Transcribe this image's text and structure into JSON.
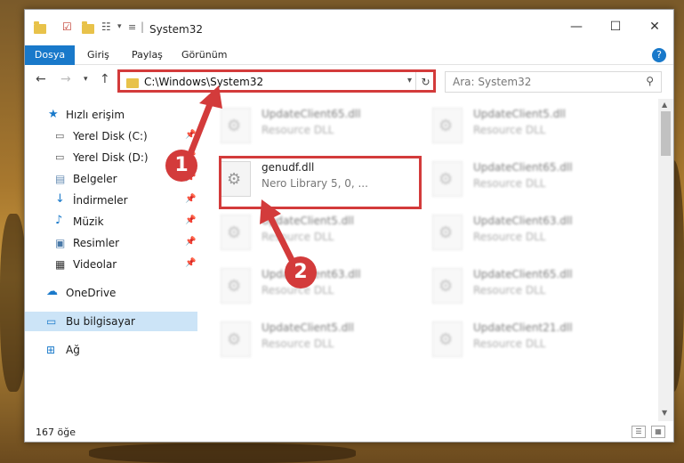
{
  "window": {
    "title": "System32",
    "controls": {
      "minimize": "—",
      "maximize": "☐",
      "close": "✕"
    }
  },
  "ribbon": {
    "tabs": [
      {
        "label": "Dosya",
        "active": true
      },
      {
        "label": "Giriş",
        "active": false
      },
      {
        "label": "Paylaş",
        "active": false
      },
      {
        "label": "Görünüm",
        "active": false
      }
    ],
    "help": "?"
  },
  "nav": {
    "address": "C:\\Windows\\System32",
    "search_placeholder": "Ara: System32"
  },
  "sidebar": {
    "items": [
      {
        "label": "Hızlı erişim",
        "icon": "star-icon",
        "pinned": false,
        "selected": false
      },
      {
        "label": "Yerel Disk (C:)",
        "icon": "drive-icon",
        "pinned": true,
        "selected": false
      },
      {
        "label": "Yerel Disk (D:)",
        "icon": "drive-icon",
        "pinned": true,
        "selected": false
      },
      {
        "label": "Belgeler",
        "icon": "documents-icon",
        "pinned": true,
        "selected": false
      },
      {
        "label": "İndirmeler",
        "icon": "download-icon",
        "pinned": true,
        "selected": false
      },
      {
        "label": "Müzik",
        "icon": "music-icon",
        "pinned": true,
        "selected": false
      },
      {
        "label": "Resimler",
        "icon": "pictures-icon",
        "pinned": true,
        "selected": false
      },
      {
        "label": "Videolar",
        "icon": "videos-icon",
        "pinned": true,
        "selected": false
      },
      {
        "label": "OneDrive",
        "icon": "cloud-icon",
        "pinned": false,
        "selected": false
      },
      {
        "label": "Bu bilgisayar",
        "icon": "computer-icon",
        "pinned": false,
        "selected": true
      },
      {
        "label": "Ağ",
        "icon": "network-icon",
        "pinned": false,
        "selected": false
      }
    ]
  },
  "files": [
    {
      "name": "UpdateClient65.dll",
      "desc": "Resource DLL",
      "highlighted": false,
      "blurred": true
    },
    {
      "name": "UpdateClient5.dll",
      "desc": "Resource DLL",
      "highlighted": false,
      "blurred": true
    },
    {
      "name": "genudf.dll",
      "desc": "Nero Library 5, 0, ...",
      "highlighted": true,
      "blurred": false
    },
    {
      "name": "UpdateClient65.dll",
      "desc": "Resource DLL",
      "highlighted": false,
      "blurred": true
    },
    {
      "name": "UpdateClient5.dll",
      "desc": "Resource DLL",
      "highlighted": false,
      "blurred": true
    },
    {
      "name": "UpdateClient63.dll",
      "desc": "Resource DLL",
      "highlighted": false,
      "blurred": true
    },
    {
      "name": "UpdateClient63.dll",
      "desc": "Resource DLL",
      "highlighted": false,
      "blurred": true
    },
    {
      "name": "UpdateClient65.dll",
      "desc": "Resource DLL",
      "highlighted": false,
      "blurred": true
    },
    {
      "name": "UpdateClient5.dll",
      "desc": "Resource DLL",
      "highlighted": false,
      "blurred": true
    },
    {
      "name": "UpdateClient21.dll",
      "desc": "Resource DLL",
      "highlighted": false,
      "blurred": true
    }
  ],
  "status": {
    "count_text": "167 öğe"
  },
  "callouts": [
    "1",
    "2"
  ],
  "colors": {
    "accent": "#1979ca",
    "highlight": "#d33b3b",
    "folder": "#e8c24a",
    "selection": "#cce4f7"
  }
}
